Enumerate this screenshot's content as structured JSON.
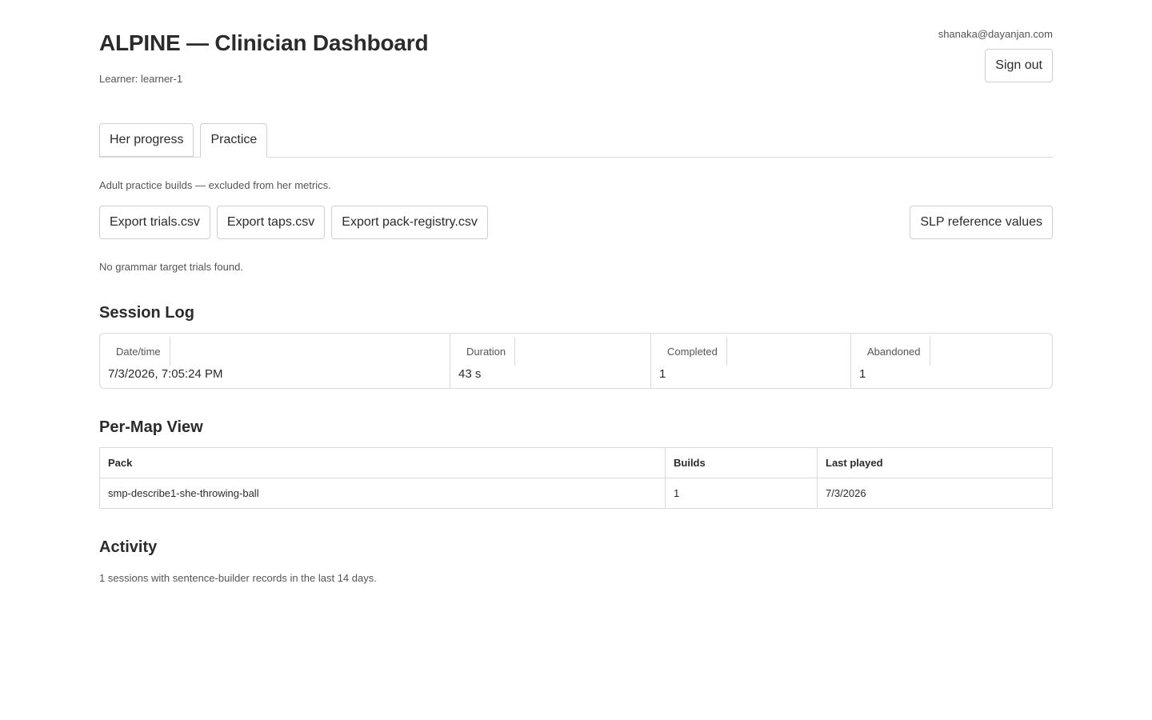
{
  "header": {
    "title": "ALPINE — Clinician Dashboard",
    "learner_line": "Learner: learner-1",
    "user_email": "shanaka@dayanjan.com",
    "sign_out_label": "Sign out"
  },
  "tabs": [
    {
      "label": "Her progress",
      "active": false
    },
    {
      "label": "Practice",
      "active": true
    }
  ],
  "practice": {
    "note": "Adult practice builds — excluded from her metrics.",
    "export_trials_label": "Export trials.csv",
    "export_taps_label": "Export taps.csv",
    "export_pack_registry_label": "Export pack-registry.csv",
    "slp_reference_label": "SLP reference values",
    "no_trials_text": "No grammar target trials found."
  },
  "session_log": {
    "title": "Session Log",
    "columns": [
      {
        "label": "Date/time",
        "value": "7/3/2026, 7:05:24 PM"
      },
      {
        "label": "Duration",
        "value": "43 s"
      },
      {
        "label": "Completed",
        "value": "1"
      },
      {
        "label": "Abandoned",
        "value": "1"
      }
    ]
  },
  "per_map": {
    "title": "Per-Map View",
    "headers": [
      "Pack",
      "Builds",
      "Last played"
    ],
    "rows": [
      [
        "smp-describe1-she-throwing-ball",
        "1",
        "7/3/2026"
      ]
    ]
  },
  "activity": {
    "title": "Activity",
    "text": "1 sessions with sentence-builder records in the last 14 days."
  }
}
